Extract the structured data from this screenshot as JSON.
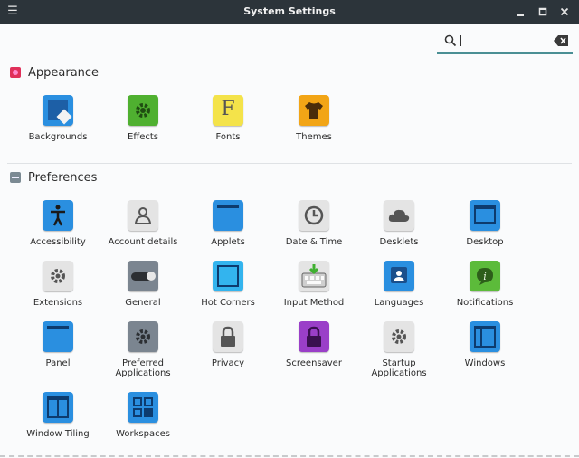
{
  "window": {
    "title": "System Settings"
  },
  "titlebar": {
    "menu_icon": "hamburger-menu-icon",
    "minimize_icon": "minimize-icon",
    "maximize_icon": "maximize-icon",
    "close_icon": "close-icon"
  },
  "search": {
    "value": "",
    "placeholder": "",
    "icon": "search-icon",
    "clear_icon": "clear-icon",
    "accent": "#4a8f94"
  },
  "sections": [
    {
      "title": "Appearance",
      "icon": "appearance-icon",
      "items": [
        {
          "label": "Backgrounds",
          "icon": "backgrounds-icon"
        },
        {
          "label": "Effects",
          "icon": "effects-icon"
        },
        {
          "label": "Fonts",
          "icon": "fonts-icon"
        },
        {
          "label": "Themes",
          "icon": "themes-icon"
        }
      ]
    },
    {
      "title": "Preferences",
      "icon": "preferences-icon",
      "items": [
        {
          "label": "Accessibility",
          "icon": "accessibility-icon"
        },
        {
          "label": "Account details",
          "icon": "account-details-icon"
        },
        {
          "label": "Applets",
          "icon": "applets-icon"
        },
        {
          "label": "Date & Time",
          "icon": "clock-icon"
        },
        {
          "label": "Desklets",
          "icon": "desklets-icon"
        },
        {
          "label": "Desktop",
          "icon": "desktop-icon"
        },
        {
          "label": "Extensions",
          "icon": "extensions-icon"
        },
        {
          "label": "General",
          "icon": "general-icon"
        },
        {
          "label": "Hot Corners",
          "icon": "hot-corners-icon"
        },
        {
          "label": "Input Method",
          "icon": "keyboard-icon"
        },
        {
          "label": "Languages",
          "icon": "languages-icon"
        },
        {
          "label": "Notifications",
          "icon": "notifications-icon"
        },
        {
          "label": "Panel",
          "icon": "panel-icon"
        },
        {
          "label": "Preferred\nApplications",
          "label_line1": "Preferred",
          "label_line2": "Applications",
          "icon": "preferred-applications-icon"
        },
        {
          "label": "Privacy",
          "icon": "privacy-icon"
        },
        {
          "label": "Screensaver",
          "icon": "screensaver-icon"
        },
        {
          "label": "Startup\nApplications",
          "label_line1": "Startup",
          "label_line2": "Applications",
          "icon": "startup-applications-icon"
        },
        {
          "label": "Windows",
          "icon": "windows-icon"
        },
        {
          "label": "Window Tiling",
          "icon": "window-tiling-icon"
        },
        {
          "label": "Workspaces",
          "icon": "workspaces-icon"
        }
      ]
    }
  ],
  "colors": {
    "titlebar": "#2c343a",
    "background": "#fafbfc",
    "blue": "#2a8fe0",
    "green": "#4fb030",
    "yellow": "#f4e34a",
    "orange": "#f2a516",
    "gray": "#cfcfcf",
    "purple": "#9a3fc8"
  }
}
